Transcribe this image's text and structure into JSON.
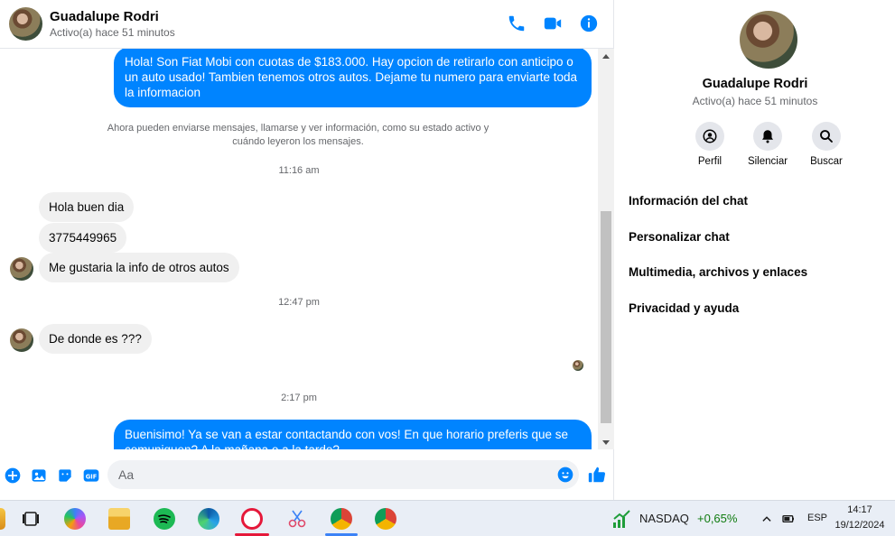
{
  "header": {
    "name": "Guadalupe Rodri",
    "status": "Activo(a) hace 51 minutos"
  },
  "messages": {
    "outgoing_1": "Hola! Son Fiat Mobi con cuotas de $183.000. Hay opcion de retirarlo con anticipo o un auto usado! Tambien tenemos otros autos. Dejame tu numero para enviarte toda la informacion",
    "system_notice": "Ahora pueden enviarse mensajes, llamarse y ver información, como su estado activo y cuándo leyeron los mensajes.",
    "time_1": "11:16 am",
    "incoming_1": "Hola buen dia",
    "incoming_2": "3775449965",
    "incoming_3": "Me gustaria la info de otros autos",
    "time_2": "12:47 pm",
    "incoming_4": "De donde es ???",
    "time_3": "2:17 pm",
    "outgoing_2": "Buenisimo! Ya se van a estar contactando con vos! En que horario preferis que se comuniquen? A la mañana o a la tarde?"
  },
  "composer": {
    "placeholder": "Aa"
  },
  "sidebar": {
    "name": "Guadalupe Rodri",
    "status": "Activo(a) hace 51 minutos",
    "actions": [
      {
        "label": "Perfil",
        "icon": "profile-icon"
      },
      {
        "label": "Silenciar",
        "icon": "bell-icon"
      },
      {
        "label": "Buscar",
        "icon": "search-icon"
      }
    ],
    "menu": [
      "Información del chat",
      "Personalizar chat",
      "Multimedia, archivos y enlaces",
      "Privacidad y ayuda"
    ]
  },
  "taskbar": {
    "nasdaq_label": "NASDAQ",
    "nasdaq_change": "+0,65%",
    "language": "ESP",
    "time": "14:17",
    "date": "19/12/2024"
  },
  "colors": {
    "accent": "#0084ff",
    "bubble_incoming": "#f0f0f0",
    "text_secondary": "#65676b",
    "positive": "#0f7b0f"
  }
}
